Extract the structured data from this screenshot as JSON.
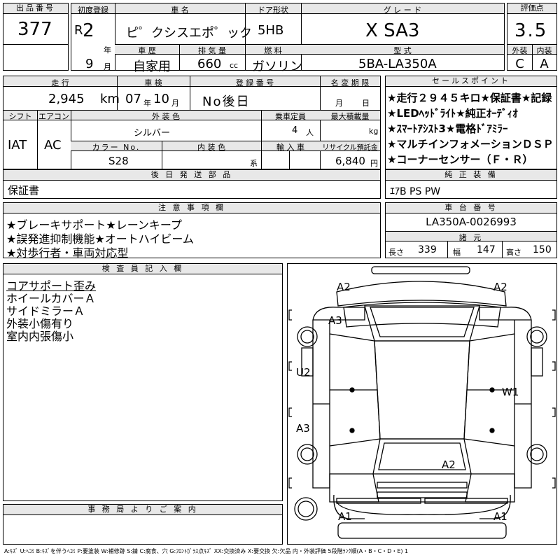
{
  "header": {
    "lot_label": "出品番号",
    "lot": "377",
    "first_reg_label": "初度登録",
    "era": "R",
    "year": "2",
    "year_unit": "年",
    "month": "9",
    "month_unit": "月",
    "car_name_label": "車 名",
    "car_name": "ピ゜クシスエポ゜ック",
    "door_label": "ドア形状",
    "door": "5HB",
    "grade_label": "グ レ ー ド",
    "grade": "X SA3",
    "score_label": "評価点",
    "score": "3.5",
    "history_label": "車 歴",
    "history": "自家用",
    "disp_label": "排 気 量",
    "disp": "660",
    "disp_unit": "cc",
    "fuel_label": "燃 料",
    "fuel": "ガソリン",
    "model_label": "型 式",
    "model": "5BA-LA350A",
    "ext_label": "外装",
    "ext": "C",
    "int_label": "内装",
    "int": "A"
  },
  "mid": {
    "mileage_label": "走 行",
    "mileage": "2,945",
    "mileage_unit": "km",
    "inspect_label": "車 検",
    "inspect_y": "07",
    "inspect_yu": "年",
    "inspect_m": "10",
    "inspect_mu": "月",
    "reg_label": "登 録 番 号",
    "reg": "No後日",
    "rename_label": "名 変 期 限",
    "rename_m": "月",
    "rename_d": "日",
    "shift_label": "シフト",
    "shift": "IAT",
    "ac_label": "エアコン",
    "ac": "AC",
    "color_label": "外 装 色",
    "color": "シルバー",
    "cap_label": "乗車定員",
    "cap": "4",
    "cap_unit": "人",
    "load_label": "最大積載量",
    "load_unit": "kg",
    "colorno_label": "カラー No.",
    "colorno": "S28",
    "intcolor_label": "内 装 色",
    "intcolor_unit": "系",
    "import_label": "輸 入 車",
    "recycle_label": "リサイクル預託金",
    "recycle": "6,840",
    "recycle_unit": "円"
  },
  "sales": {
    "label": "セールスポイント",
    "points": [
      "★走行２９４５キロ★保証書★記録",
      "★LEDﾍｯﾄﾞﾗｲﾄ★純正ｵｰﾃﾞｨｵ",
      "★ｽﾏｰﾄｱｼｽﾄ3★電格ﾄﾞｱﾐﾗｰ",
      "★マルチインフォメーションＤＳＰ",
      "★コーナーセンサー（Ｆ・Ｒ）"
    ]
  },
  "later": {
    "label": "後 日 発 送 部 品",
    "value": "保証書"
  },
  "equip": {
    "label": "純 正 装 備",
    "value": "ｴｱB PS PW"
  },
  "caution": {
    "label": "注 意 事 項 欄",
    "lines": [
      "★ブレーキサポート★レーンキープ",
      "★誤発進抑制機能★オートハイビーム",
      "★対歩行者・車両対応型"
    ]
  },
  "chassis": {
    "label": "車 台 番 号",
    "value": "LA350A-0026993"
  },
  "specs": {
    "label": "諸 元",
    "len_label": "長さ",
    "len": "339",
    "wid_label": "幅",
    "wid": "147",
    "hei_label": "高さ",
    "hei": "150"
  },
  "inspector": {
    "label": "検 査 員 記 入 欄",
    "lines": [
      "コアサポート歪み",
      "ホイールカバーＡ",
      "サイドミラーＡ",
      "外装小傷有り",
      "室内内張傷小"
    ]
  },
  "office": {
    "label": "事 務 局 よ り ご 案 内"
  },
  "diagram": {
    "marks": [
      "A2",
      "A2",
      "A3",
      "U2",
      "W1",
      "A3",
      "A2",
      "A1",
      "A1"
    ]
  },
  "footer": "A:ｷｽﾞ U:ﾍｺﾐ B:ｷｽﾞを伴うﾍｺﾐ P:要塗装 W:補修跡 S:錆 C:腐食、穴 G:ﾌﾛﾝﾄｶﾞﾗｽ点ｷｽﾞ XX:交換済み X:要交換 欠:欠品 内・外装評価 5段階ﾗﾝｸ順(A・B・C・D・E) 1"
}
